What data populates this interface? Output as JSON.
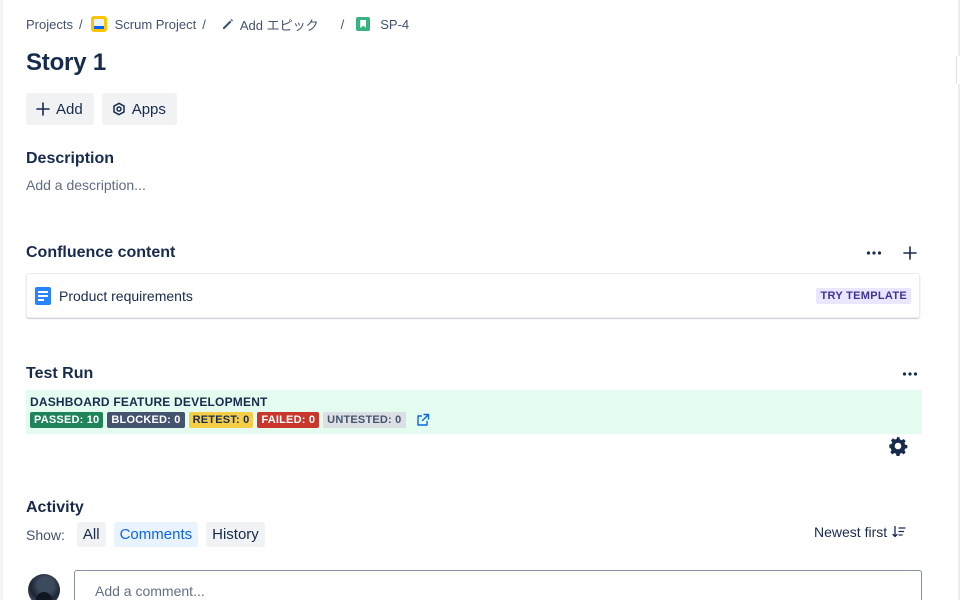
{
  "breadcrumb": {
    "projects": "Projects",
    "project": "Scrum Project",
    "epic": "Add エピック",
    "issue": "SP-4",
    "separator": "/"
  },
  "issue": {
    "title": "Story 1"
  },
  "actions": {
    "add_label": "Add",
    "apps_label": "Apps"
  },
  "description": {
    "heading": "Description",
    "placeholder": "Add a description..."
  },
  "confluence": {
    "heading": "Confluence content",
    "item_label": "Product requirements",
    "template_button": "TRY TEMPLATE"
  },
  "test_run": {
    "heading": "Test Run",
    "name": "DASHBOARD FEATURE DEVELOPMENT",
    "badges": [
      {
        "label": "PASSED: 10",
        "bg": "#1f845a",
        "fg": "#ffffff"
      },
      {
        "label": "BLOCKED: 0",
        "bg": "#44546f",
        "fg": "#ffffff"
      },
      {
        "label": "RETEST: 0",
        "bg": "#f5cd47",
        "fg": "#172b4d"
      },
      {
        "label": "FAILED: 0",
        "bg": "#c9372c",
        "fg": "#ffffff"
      },
      {
        "label": "UNTESTED: 0",
        "bg": "#dcdfe4",
        "fg": "#44546f"
      }
    ]
  },
  "activity": {
    "heading": "Activity",
    "show_label": "Show:",
    "filters": [
      "All",
      "Comments",
      "History"
    ],
    "active_filter": "Comments",
    "sort_label": "Newest first",
    "comment_placeholder": "Add a comment..."
  },
  "icons": {
    "project": "project-avatar-icon",
    "epic": "pencil-icon",
    "issue": "story-icon",
    "add": "plus-icon",
    "apps": "apps-icon",
    "more": "more-icon",
    "doc": "document-icon",
    "external": "external-link-icon",
    "settings": "gear-icon",
    "sort": "sort-icon"
  },
  "colors": {
    "accent": "#0c66e4",
    "run_bg": "#e3fcef",
    "template_bg": "#eae6ff"
  }
}
